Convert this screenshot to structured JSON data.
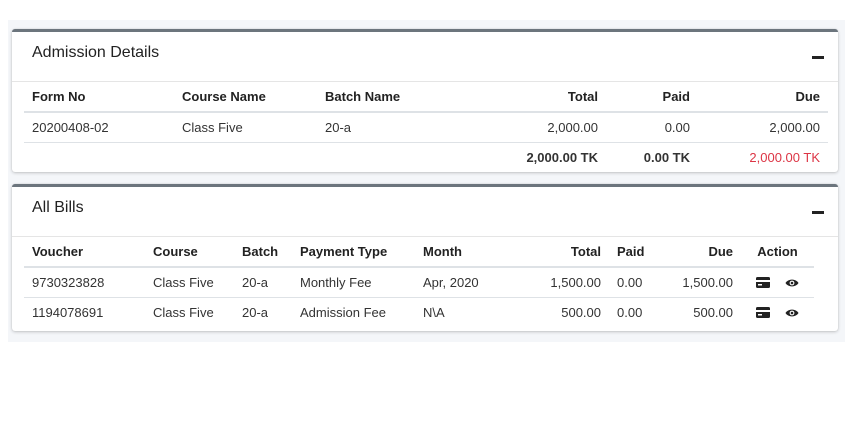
{
  "admission": {
    "title": "Admission Details",
    "headers": {
      "form_no": "Form No",
      "course_name": "Course Name",
      "batch_name": "Batch Name",
      "total": "Total",
      "paid": "Paid",
      "due": "Due"
    },
    "rows": [
      {
        "form_no": "20200408-02",
        "course_name": "Class Five",
        "batch_name": "20-a",
        "total": "2,000.00",
        "paid": "0.00",
        "due": "2,000.00"
      }
    ],
    "totals": {
      "total": "2,000.00 TK",
      "paid": "0.00 TK",
      "due": "2,000.00 TK"
    }
  },
  "bills": {
    "title": "All Bills",
    "headers": {
      "voucher": "Voucher",
      "course": "Course",
      "batch": "Batch",
      "payment_type": "Payment Type",
      "month": "Month",
      "total": "Total",
      "paid": "Paid",
      "due": "Due",
      "action": "Action"
    },
    "rows": [
      {
        "voucher": "9730323828",
        "course": "Class Five",
        "batch": "20-a",
        "payment_type": "Monthly Fee",
        "month": "Apr, 2020",
        "total": "1,500.00",
        "paid": "0.00",
        "due": "1,500.00"
      },
      {
        "voucher": "1194078691",
        "course": "Class Five",
        "batch": "20-a",
        "payment_type": "Admission Fee",
        "month": "N\\A",
        "total": "500.00",
        "paid": "0.00",
        "due": "500.00"
      }
    ]
  },
  "icons": {
    "collapse": "minus-icon",
    "pay": "credit-card-icon",
    "view": "eye-icon"
  },
  "colors": {
    "due_total": "#dc3545",
    "card_border": "#6c757d"
  }
}
